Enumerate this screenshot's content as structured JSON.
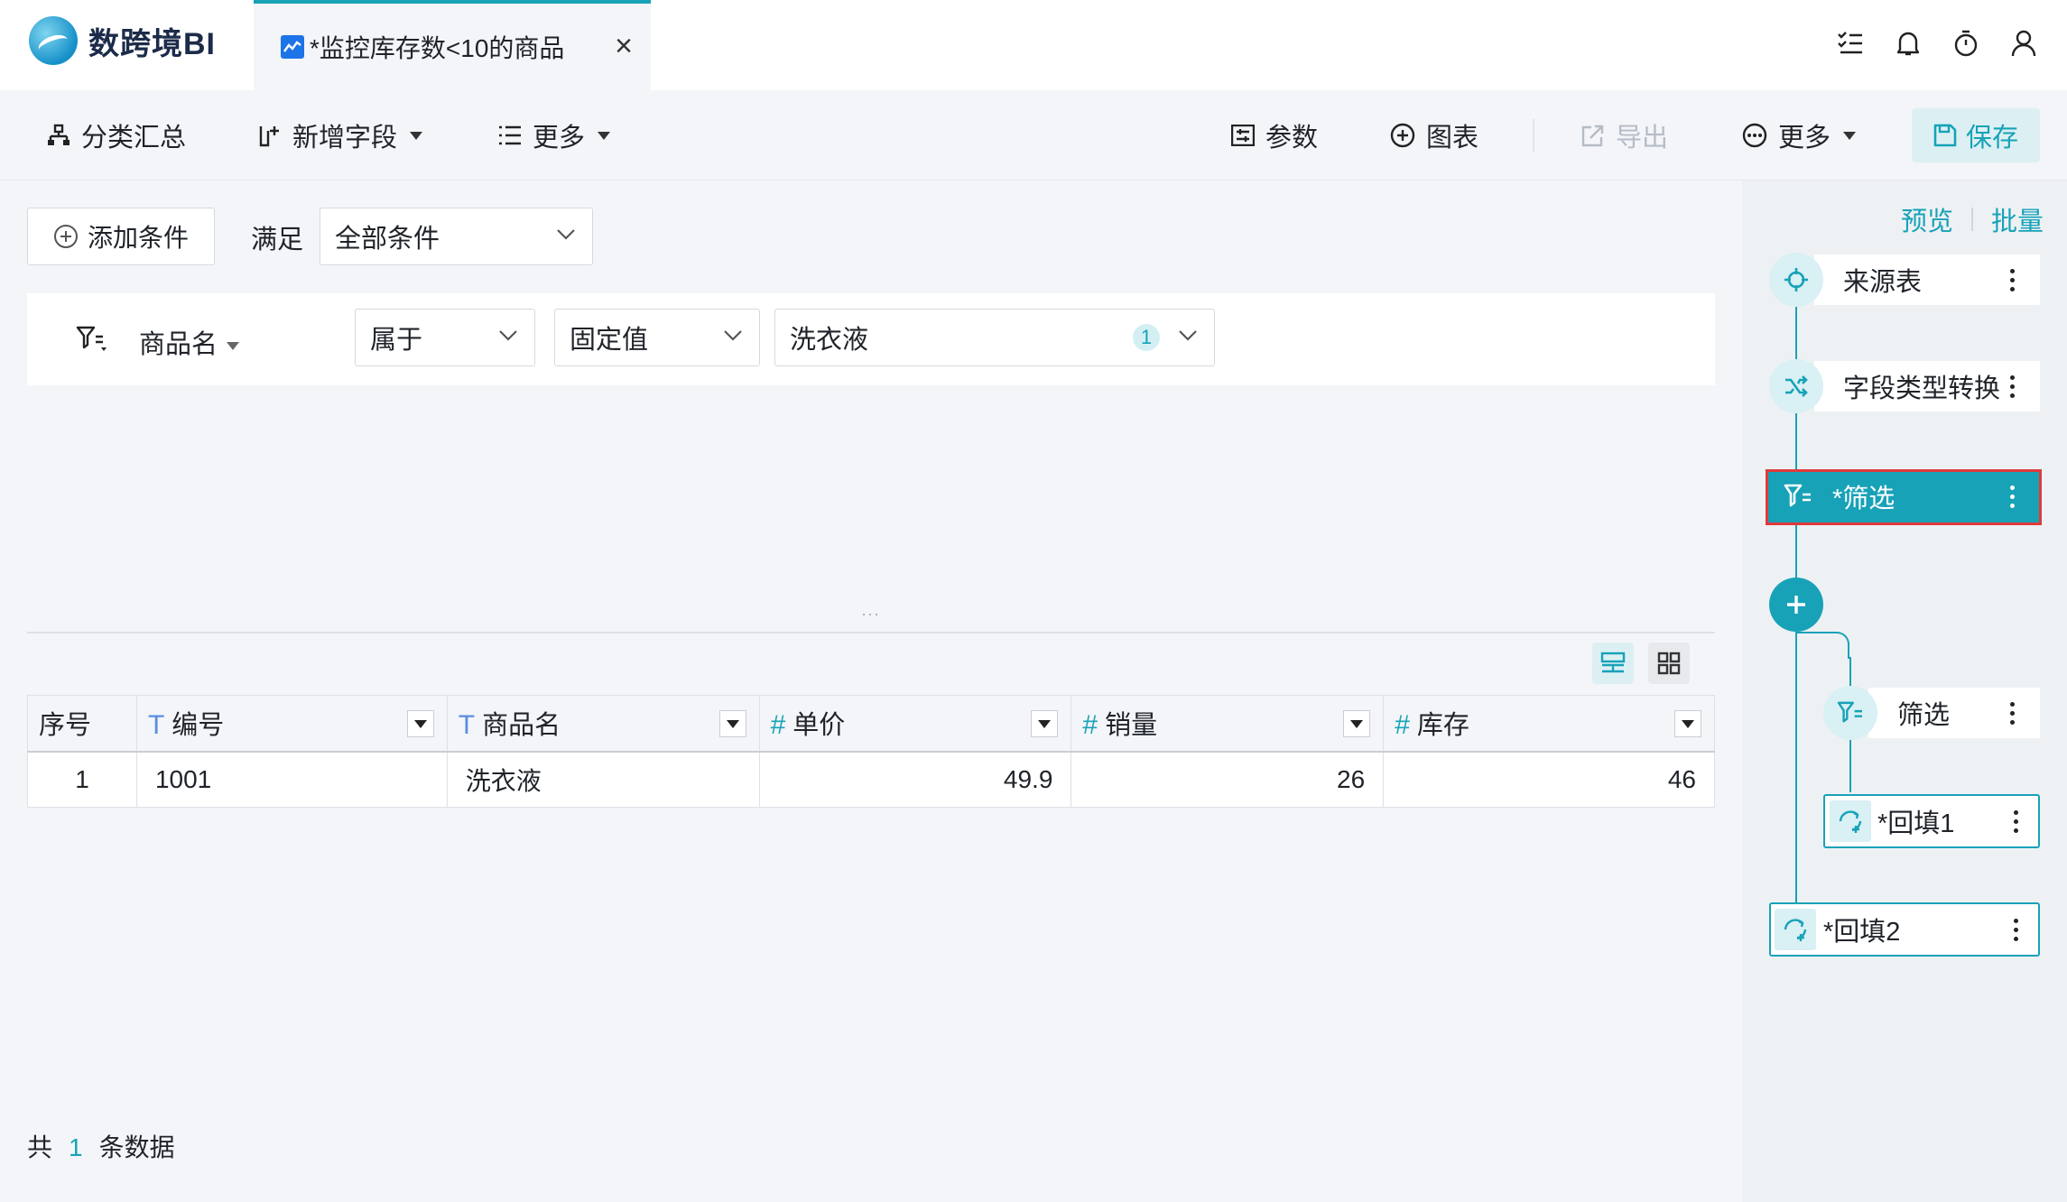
{
  "app": {
    "brand": "数跨境BI"
  },
  "tab": {
    "title": "*监控库存数<10的商品",
    "close": "×"
  },
  "header_icons": [
    "task-list-icon",
    "bell-icon",
    "timer-icon",
    "user-icon"
  ],
  "toolbar": {
    "group_summary": "分类汇总",
    "add_field": "新增字段",
    "more_left": "更多",
    "params": "参数",
    "chart": "图表",
    "export": "导出",
    "more_right": "更多",
    "save": "保存"
  },
  "condition": {
    "add_button": "添加条件",
    "satisfy_label": "满足",
    "match_mode": "全部条件"
  },
  "filter_rule": {
    "field": "商品名",
    "operator": "属于",
    "value_type": "固定值",
    "value": "洗衣液",
    "value_count": "1"
  },
  "table": {
    "columns": [
      {
        "label": "序号",
        "type_icon": ""
      },
      {
        "label": "编号",
        "type_icon": "T"
      },
      {
        "label": "商品名",
        "type_icon": "T"
      },
      {
        "label": "单价",
        "type_icon": "#"
      },
      {
        "label": "销量",
        "type_icon": "#"
      },
      {
        "label": "库存",
        "type_icon": "#"
      }
    ],
    "rows": [
      [
        "1",
        "1001",
        "洗衣液",
        "49.9",
        "26",
        "46"
      ]
    ]
  },
  "footer": {
    "prefix": "共",
    "count": "1",
    "suffix": "条数据"
  },
  "flow": {
    "preview": "预览",
    "batch": "批量",
    "nodes": [
      {
        "label": "来源表"
      },
      {
        "label": "字段类型转换"
      },
      {
        "label": "*筛选"
      },
      {
        "label": "筛选"
      },
      {
        "label": "*回填1"
      },
      {
        "label": "*回填2"
      }
    ]
  },
  "colors": {
    "accent": "#17a2b8",
    "highlight_border": "#e03a3a",
    "panel_bg": "#f3f5f8"
  }
}
